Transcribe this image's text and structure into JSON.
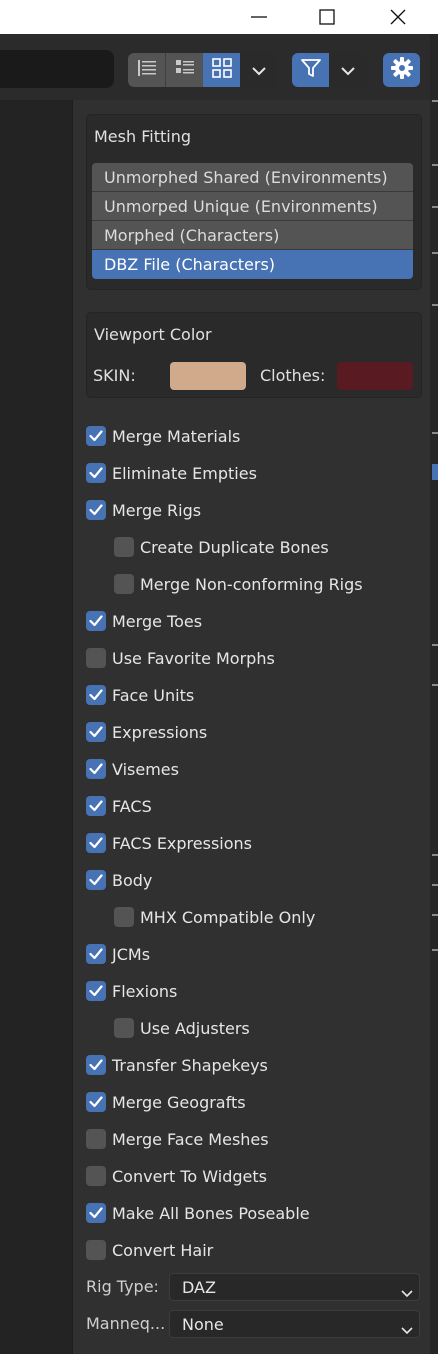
{
  "colors": {
    "accent": "#4772b3",
    "panel_bg": "#303030",
    "skin_color": "#d0aa8a",
    "clothes_color": "#5a1a22"
  },
  "icons": {
    "minimize": "minimize-icon",
    "maximize": "maximize-icon",
    "close": "close-icon",
    "filter": "filter-icon",
    "settings": "gear-icon"
  },
  "mesh_fitting": {
    "title": "Mesh Fitting",
    "options": [
      {
        "label": "Unmorphed Shared (Environments)",
        "selected": false
      },
      {
        "label": "Unmorped Unique (Environments)",
        "selected": false
      },
      {
        "label": "Morphed (Characters)",
        "selected": false
      },
      {
        "label": "DBZ File (Characters)",
        "selected": true
      }
    ]
  },
  "viewport_color": {
    "title": "Viewport Color",
    "skin_label": "SKIN:",
    "clothes_label": "Clothes:"
  },
  "options": [
    {
      "label": "Merge Materials",
      "checked": true,
      "indent": false
    },
    {
      "label": "Eliminate Empties",
      "checked": true,
      "indent": false
    },
    {
      "label": "Merge Rigs",
      "checked": true,
      "indent": false
    },
    {
      "label": "Create Duplicate Bones",
      "checked": false,
      "indent": true
    },
    {
      "label": "Merge Non-conforming Rigs",
      "checked": false,
      "indent": true
    },
    {
      "label": "Merge Toes",
      "checked": true,
      "indent": false
    },
    {
      "label": "Use Favorite Morphs",
      "checked": false,
      "indent": false
    },
    {
      "label": "Face Units",
      "checked": true,
      "indent": false
    },
    {
      "label": "Expressions",
      "checked": true,
      "indent": false
    },
    {
      "label": "Visemes",
      "checked": true,
      "indent": false
    },
    {
      "label": "FACS",
      "checked": true,
      "indent": false
    },
    {
      "label": "FACS Expressions",
      "checked": true,
      "indent": false
    },
    {
      "label": "Body",
      "checked": true,
      "indent": false
    },
    {
      "label": "MHX Compatible Only",
      "checked": false,
      "indent": true
    },
    {
      "label": "JCMs",
      "checked": true,
      "indent": false
    },
    {
      "label": "Flexions",
      "checked": true,
      "indent": false
    },
    {
      "label": "Use Adjusters",
      "checked": false,
      "indent": true
    },
    {
      "label": "Transfer Shapekeys",
      "checked": true,
      "indent": false
    },
    {
      "label": "Merge Geografts",
      "checked": true,
      "indent": false
    },
    {
      "label": "Merge Face Meshes",
      "checked": false,
      "indent": false
    },
    {
      "label": "Convert To Widgets",
      "checked": false,
      "indent": false
    },
    {
      "label": "Make All Bones Poseable",
      "checked": true,
      "indent": false
    },
    {
      "label": "Convert Hair",
      "checked": false,
      "indent": false
    }
  ],
  "rig_type": {
    "label": "Rig Type:",
    "value": "DAZ"
  },
  "mannequin": {
    "label": "Manneq...",
    "value": "None"
  }
}
